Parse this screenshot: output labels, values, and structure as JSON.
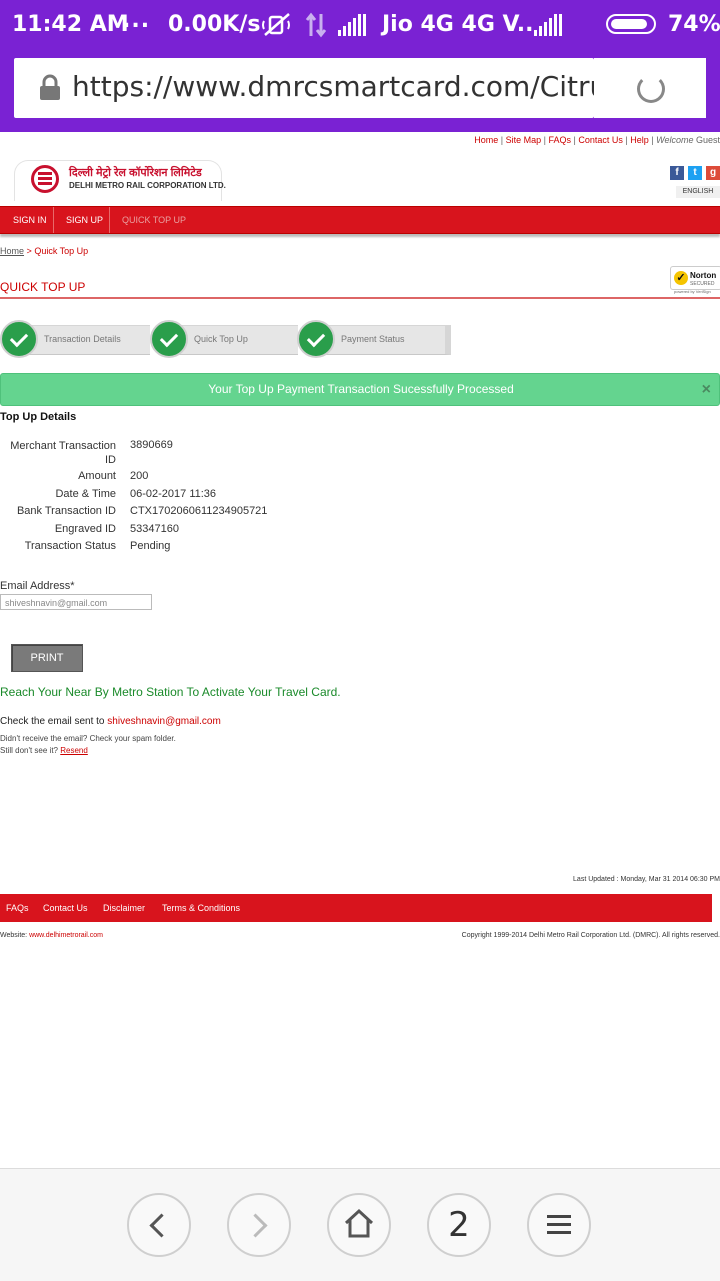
{
  "status_bar": {
    "time": "11:42 AM",
    "dots": "...",
    "speed": "0.00K/s",
    "carrier": "Jio 4G 4G V..",
    "battery": "74%",
    "battery_level": 0.74,
    "icons": [
      "mute-icon",
      "data-arrows-icon",
      "signal-icon",
      "signal-icon",
      "battery-icon"
    ]
  },
  "browser": {
    "url": "https://www.dmrcsmartcard.com/Citrus_P",
    "reload_icon": "reload-icon",
    "lock_icon": "lock-icon"
  },
  "header": {
    "top_links": [
      "Home",
      "Site Map",
      "FAQs",
      "Contact Us",
      "Help"
    ],
    "welcome_label": "Welcome",
    "welcome_user": "Guest",
    "logo_hindi": "दिल्ली मेट्रो रेल कॉर्पोरेशन लिमिटेड",
    "logo_english": "DELHI METRO RAIL CORPORATION LTD.",
    "social": [
      "facebook-icon",
      "twitter-icon",
      "google-plus-icon"
    ],
    "language": "ENGLISH"
  },
  "nav": {
    "items": [
      "SIGN IN",
      "SIGN UP",
      "QUICK TOP UP"
    ]
  },
  "breadcrumb": {
    "home": "Home",
    "sep": ">",
    "current": "Quick Top Up"
  },
  "norton": {
    "title": "Norton",
    "sub": "SECURED",
    "powered": "powered by VeriSign"
  },
  "page": {
    "title": "QUICK TOP UP",
    "steps": [
      "Transaction Details",
      "Quick Top Up",
      "Payment Status"
    ],
    "alert": "Your Top Up Payment Transaction Sucessfully Processed",
    "alert_close": "×",
    "details_heading": "Top Up Details",
    "details": [
      {
        "label": "Merchant Transaction ID",
        "value": "3890669"
      },
      {
        "label": "Amount",
        "value": "200"
      },
      {
        "label": "Date & Time",
        "value": "06-02-2017 11:36"
      },
      {
        "label": "Bank Transaction ID",
        "value": "CTX1702060611234905721"
      },
      {
        "label": "Engraved ID",
        "value": "53347160"
      },
      {
        "label": "Transaction Status",
        "value": "Pending"
      }
    ],
    "email_label": "Email Address*",
    "email_value": "shiveshnavin@gmail.com",
    "print_label": "PRINT",
    "reach_text": "Reach Your Near By Metro Station To Activate Your Travel Card.",
    "check_prefix": "Check the email sent to",
    "check_email": "shiveshnavin@gmail.com",
    "spam_note": "Didn't receive the email? Check your spam folder.",
    "still_prefix": "Still don't see it?",
    "resend": "Resend"
  },
  "footer": {
    "last_updated": "Last Updated : Monday, Mar 31 2014 06:30 PM",
    "links": [
      "FAQs",
      "Contact Us",
      "Disclaimer",
      "Terms & Conditions"
    ],
    "website_label": "Website:",
    "website_url": "www.delhimetrorail.com",
    "copyright": "Copyright 1999-2014 Delhi Metro Rail Corporation Ltd. (DMRC). All rights reserved."
  },
  "bottom_nav": {
    "tab_count": "2",
    "icons": [
      "back-icon",
      "forward-icon",
      "home-icon",
      "tabs-icon",
      "menu-icon"
    ]
  },
  "colors": {
    "status_bar": "#7a22d3",
    "brand_red": "#d8141d",
    "success_green": "#64d48f",
    "step_green": "#2a9e4b"
  }
}
